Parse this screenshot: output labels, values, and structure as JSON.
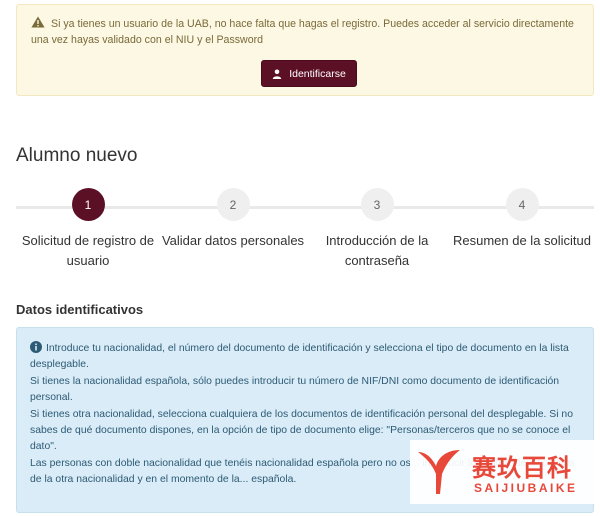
{
  "notice": {
    "text": "Si ya tienes un usuario de la UAB, no hace falta que hagas el registro. Puedes acceder al servicio directamente una vez hayas validado con el NIU y el Password",
    "button_label": "Identificarse"
  },
  "page_title": "Alumno nuevo",
  "steps": [
    {
      "number": "1",
      "label": "Solicitud de registro de usuario",
      "active": true
    },
    {
      "number": "2",
      "label": "Validar datos personales",
      "active": false
    },
    {
      "number": "3",
      "label": "Introducción de la contraseña",
      "active": false
    },
    {
      "number": "4",
      "label": "Resumen de la solicitud",
      "active": false
    }
  ],
  "section_title": "Datos identificativos",
  "info": {
    "p1": "Introduce tu nacionalidad, el número del documento de identificación y selecciona el tipo de documento en la lista desplegable.",
    "p2": "Si tienes la nacionalidad española, sólo puedes introducir tu número de NIF/DNI como documento de identificación personal.",
    "p3": "Si tienes otra nacionalidad, selecciona cualquiera de los documentos de identificación personal del desplegable. Si no sabes de qué documento dispones, en la opción de tipo de documento elige: \"Personas/terceros que no se conoce el dato\".",
    "p4": "Las personas con doble nacionalidad que tenéis nacionalidad española pero no os... introducir los datos identificativos de la otra nacionalidad y en el momento de la... española."
  },
  "watermark": {
    "cn": "赛玖百科",
    "en": "SAIJIUBAIKE"
  },
  "colors": {
    "brand": "#5c1026",
    "warning_bg": "#fcf8e3",
    "info_bg": "#d9ecf7",
    "watermark": "#e8483a"
  },
  "icons": {
    "warning": "warning-triangle-icon",
    "user": "user-icon",
    "info": "info-circle-icon"
  }
}
